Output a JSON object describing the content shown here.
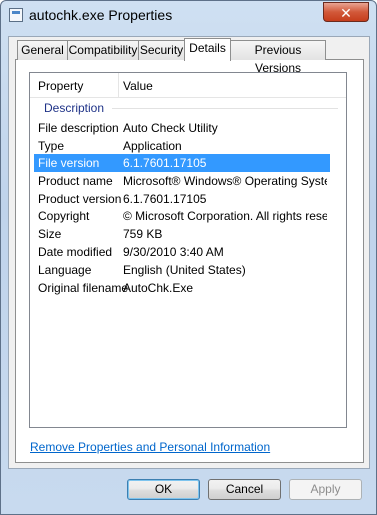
{
  "window": {
    "title": "autochk.exe Properties",
    "close_glyph": "✕"
  },
  "tabs": [
    {
      "label": "General"
    },
    {
      "label": "Compatibility"
    },
    {
      "label": "Security"
    },
    {
      "label": "Details"
    },
    {
      "label": "Previous Versions"
    }
  ],
  "active_tab": "Details",
  "columns": {
    "property": "Property",
    "value": "Value"
  },
  "group": "Description",
  "rows": [
    {
      "property": "File description",
      "value": "Auto Check Utility"
    },
    {
      "property": "Type",
      "value": "Application"
    },
    {
      "property": "File version",
      "value": "6.1.7601.17105"
    },
    {
      "property": "Product name",
      "value": "Microsoft® Windows® Operating System"
    },
    {
      "property": "Product version",
      "value": "6.1.7601.17105"
    },
    {
      "property": "Copyright",
      "value": "© Microsoft Corporation. All rights reserv..."
    },
    {
      "property": "Size",
      "value": "759 KB"
    },
    {
      "property": "Date modified",
      "value": "9/30/2010 3:40 AM"
    },
    {
      "property": "Language",
      "value": "English (United States)"
    },
    {
      "property": "Original filename",
      "value": "AutoChk.Exe"
    }
  ],
  "selected_row": "File version",
  "link": "Remove Properties and Personal Information",
  "buttons": {
    "ok": "OK",
    "cancel": "Cancel",
    "apply": "Apply"
  },
  "colors": {
    "selection": "#3399ff",
    "group_header": "#1e3287",
    "link": "#0066cc"
  }
}
